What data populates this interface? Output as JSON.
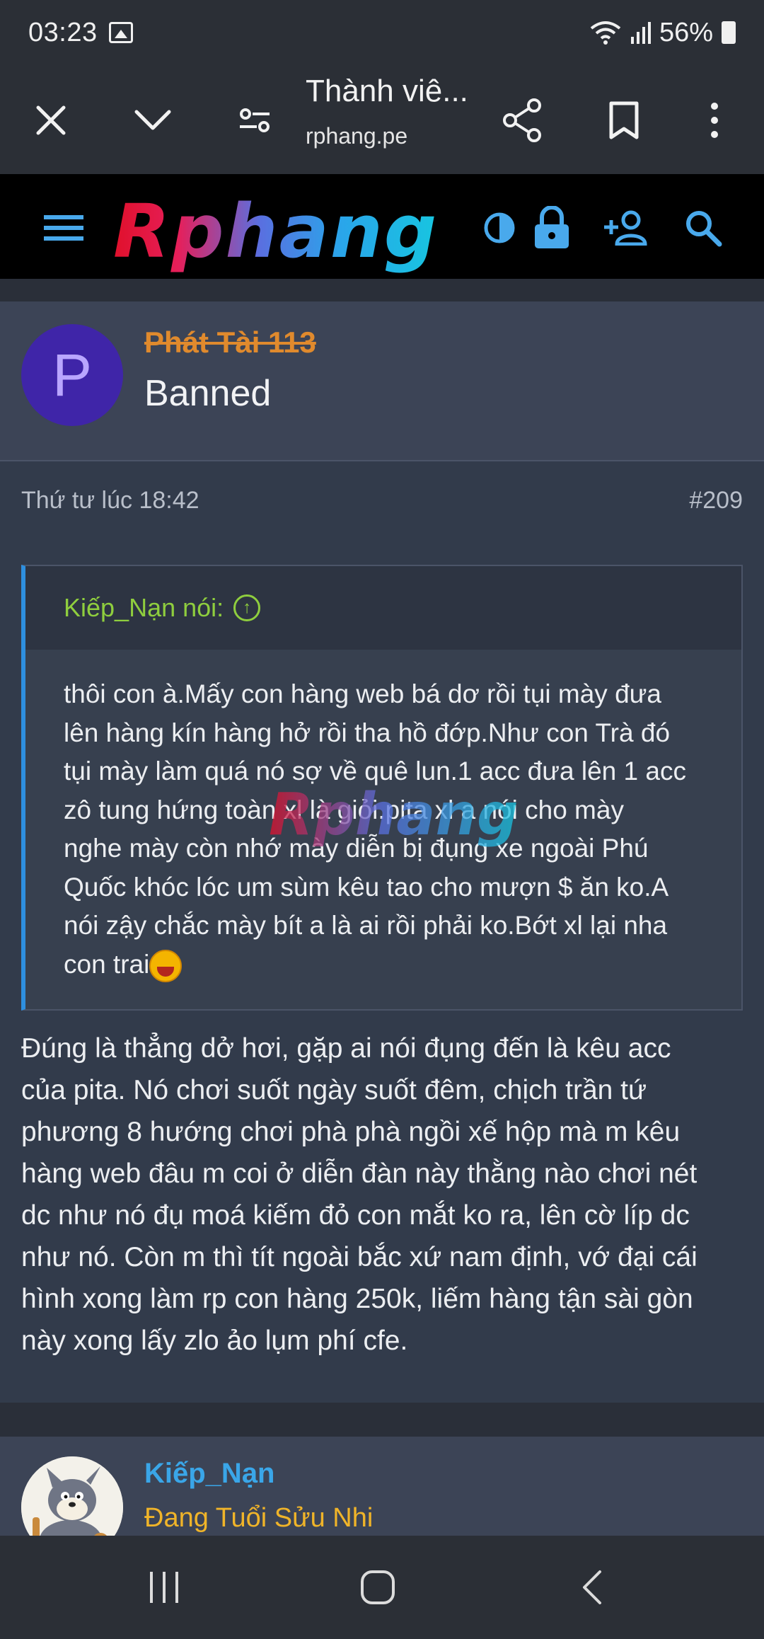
{
  "status_bar": {
    "time": "03:23",
    "battery": "56%"
  },
  "browser": {
    "page_title": "Thành viê...",
    "url": "rphang.pe"
  },
  "site": {
    "logo_text": "Rphang"
  },
  "post1": {
    "avatar_letter": "P",
    "username": "Phát Tài 113",
    "user_title": "Banned",
    "date": "Thứ tư lúc 18:42",
    "post_number": "#209",
    "quote_author": "Kiếp_Nạn nói:",
    "quote_text": "thôi con à.Mấy con hàng web bá dơ rồi tụi mày đưa\nlên hàng kín hàng hở rồi tha hồ đớp.Như con Trà đó\ntụi mày làm quá nó sợ về quê lun.1 acc đưa lên 1 acc\nzô tung hứng toàn xl là giỏi.pita xl a nói cho mày\nnghe mày còn nhớ mày diễn bị đụng xe ngoài Phú\nQuốc khóc lóc um sùm kêu tao cho mượn $ ăn ko.A\nnói zậy chắc mày bít a là ai rồi phải ko.Bớt xl lại nha\ncon trai",
    "body": "Đúng là thẳng dở hơi, gặp ai nói đụng đến là kêu acc\ncủa pita. Nó chơi suốt ngày suốt đêm, chịch trần tứ\nphương 8 hướng chơi phà phà ngồi xế hộp mà m kêu\nhàng web đâu m coi ở diễn đàn này thằng nào chơi nét\ndc như nó đụ moá kiếm đỏ con mắt ko ra, lên cờ líp dc\nnhư nó. Còn m thì tít ngoài bắc xứ nam định, vớ đại cái\nhình xong làm rp con hàng 250k, liếm hàng tận sài gòn\nnày xong lấy zlo ảo lụm phí cfe."
  },
  "post2": {
    "username": "Kiếp_Nạn",
    "user_title": "Đang Tuổi Sửu Nhi"
  },
  "colors": {
    "accent": "#3aa6e8",
    "quote_green": "#8fce3e",
    "banned_orange": "#e08a2d"
  }
}
